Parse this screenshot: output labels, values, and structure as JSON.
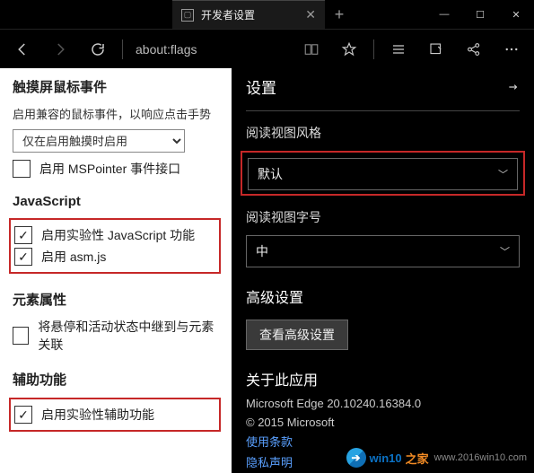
{
  "window": {
    "tab_label": "开发者设置",
    "newtab": "+",
    "min": "—",
    "max": "☐",
    "close": "✕"
  },
  "nav": {
    "url": "about:flags"
  },
  "left": {
    "touch": {
      "heading": "触摸屏鼠标事件",
      "desc": "启用兼容的鼠标事件，以响应点击手势",
      "select_value": "仅在启用触摸时启用",
      "mspointer_label": "启用 MSPointer 事件接口"
    },
    "js": {
      "heading": "JavaScript",
      "exp_label": "启用实验性 JavaScript 功能",
      "asm_label": "启用 asm.js"
    },
    "elem": {
      "heading": "元素属性",
      "suspend_label": "将悬停和活动状态中继到与元素关联"
    },
    "a11y": {
      "heading": "辅助功能",
      "exp_label": "启用实验性辅助功能"
    }
  },
  "right": {
    "panel_title": "设置",
    "style_label": "阅读视图风格",
    "style_value": "默认",
    "size_label": "阅读视图字号",
    "size_value": "中",
    "advanced_heading": "高级设置",
    "advanced_btn": "查看高级设置",
    "about_heading": "关于此应用",
    "version": "Microsoft Edge 20.10240.16384.0",
    "copyright": "© 2015 Microsoft",
    "terms_link": "使用条款",
    "privacy_link": "隐私声明"
  },
  "watermark": {
    "brand": "win10",
    "suffix": "之家",
    "url": "www.2016win10.com"
  }
}
